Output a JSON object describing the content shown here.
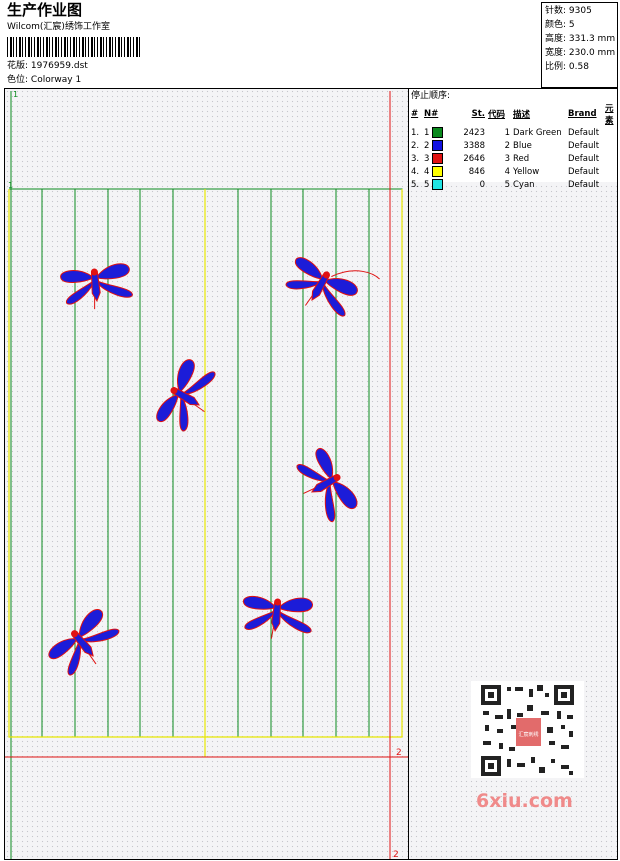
{
  "header": {
    "title": "生产作业图",
    "studio": "Wilcom(汇宸)绣饰工作室",
    "design_label": "花版:",
    "design_value": "1976959.dst",
    "colorway_label": "色位:",
    "colorway_value": "Colorway 1"
  },
  "stats": {
    "stitches_label": "针数:",
    "stitches_value": "9305",
    "colors_label": "颜色:",
    "colors_value": "5",
    "height_label": "高度:",
    "height_value": "331.3 mm",
    "width_label": "宽度:",
    "width_value": "230.0 mm",
    "scale_label": "比例:",
    "scale_value": "0.58"
  },
  "stop_sequence": {
    "title": "停止顺序:",
    "headers": [
      "#",
      "N#",
      "St.",
      "代码",
      "描述",
      "Brand",
      "元素"
    ],
    "rows": [
      {
        "n": "1.",
        "stop": "1",
        "color": "#0a8a1e",
        "stitches": "2423",
        "code": "1",
        "desc": "Dark Green",
        "brand": "Default"
      },
      {
        "n": "2.",
        "stop": "2",
        "color": "#1212e0",
        "stitches": "3388",
        "code": "2",
        "desc": "Blue",
        "brand": "Default"
      },
      {
        "n": "3.",
        "stop": "3",
        "color": "#e01212",
        "stitches": "2646",
        "code": "3",
        "desc": "Red",
        "brand": "Default"
      },
      {
        "n": "4.",
        "stop": "4",
        "color": "#ffff00",
        "stitches": "846",
        "code": "4",
        "desc": "Yellow",
        "brand": "Default"
      },
      {
        "n": "5.",
        "stop": "5",
        "color": "#22e4e4",
        "stitches": "0",
        "code": "5",
        "desc": "Cyan",
        "brand": "Default"
      }
    ]
  },
  "canvas": {
    "marker_start": "1",
    "marker_end": "2",
    "accent_green": "#0a8a1e",
    "accent_blue": "#1212e0",
    "accent_red": "#e01212",
    "accent_yellow": "#ffff00"
  },
  "watermark": {
    "brand": "6xiu.com",
    "seal": "汇宸刺绣"
  }
}
